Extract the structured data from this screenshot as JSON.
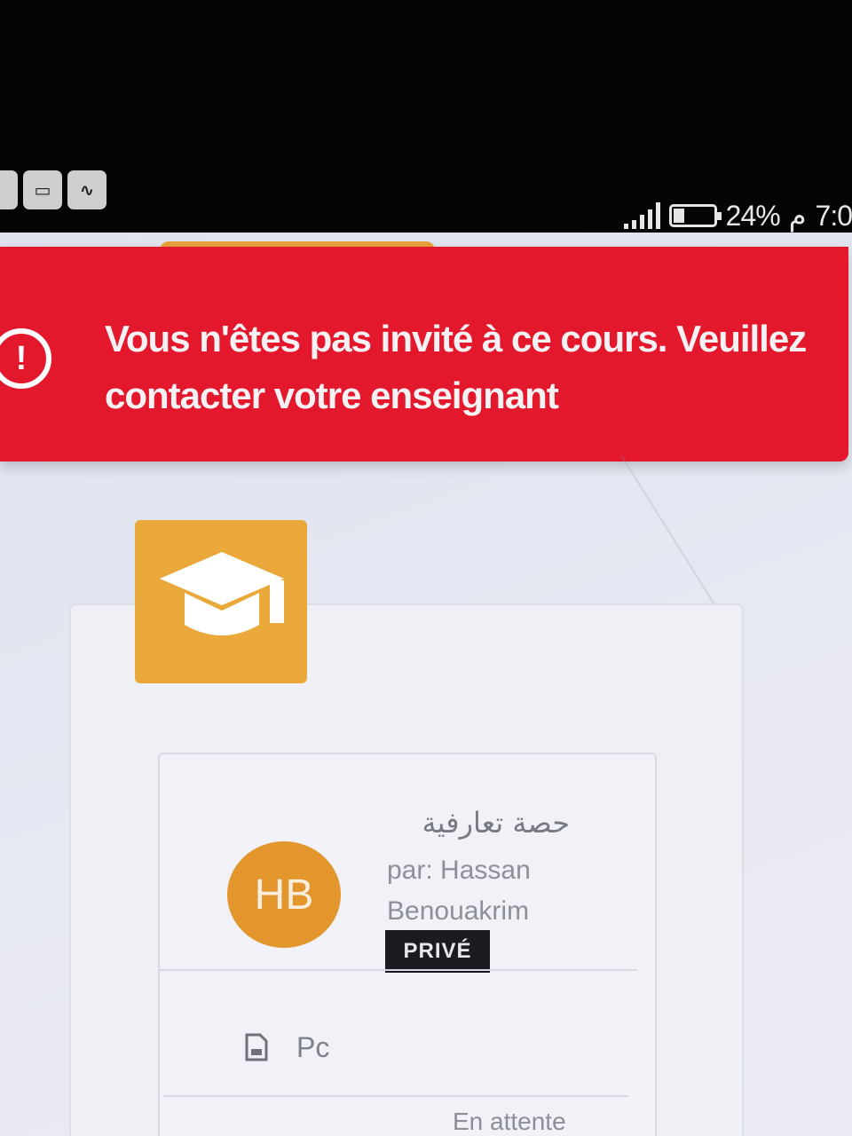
{
  "status_bar": {
    "battery": "24%",
    "ampm": "م",
    "time": "7:0",
    "notification_icons": [
      "image-icon",
      "keyboard-icon",
      "activity-icon"
    ]
  },
  "error_banner": {
    "message": "Vous n'êtes pas invité à ce cours. Veuillez contacter votre enseignant",
    "color": "#e3182d"
  },
  "course": {
    "title": "حصة تعارفية",
    "author": "par: Hassan Benouakrim",
    "avatar_initials": "HB",
    "visibility_badge": "PRIVÉ",
    "content_item": "Pc",
    "status": "En attente",
    "accent_color": "#eaa93a"
  }
}
